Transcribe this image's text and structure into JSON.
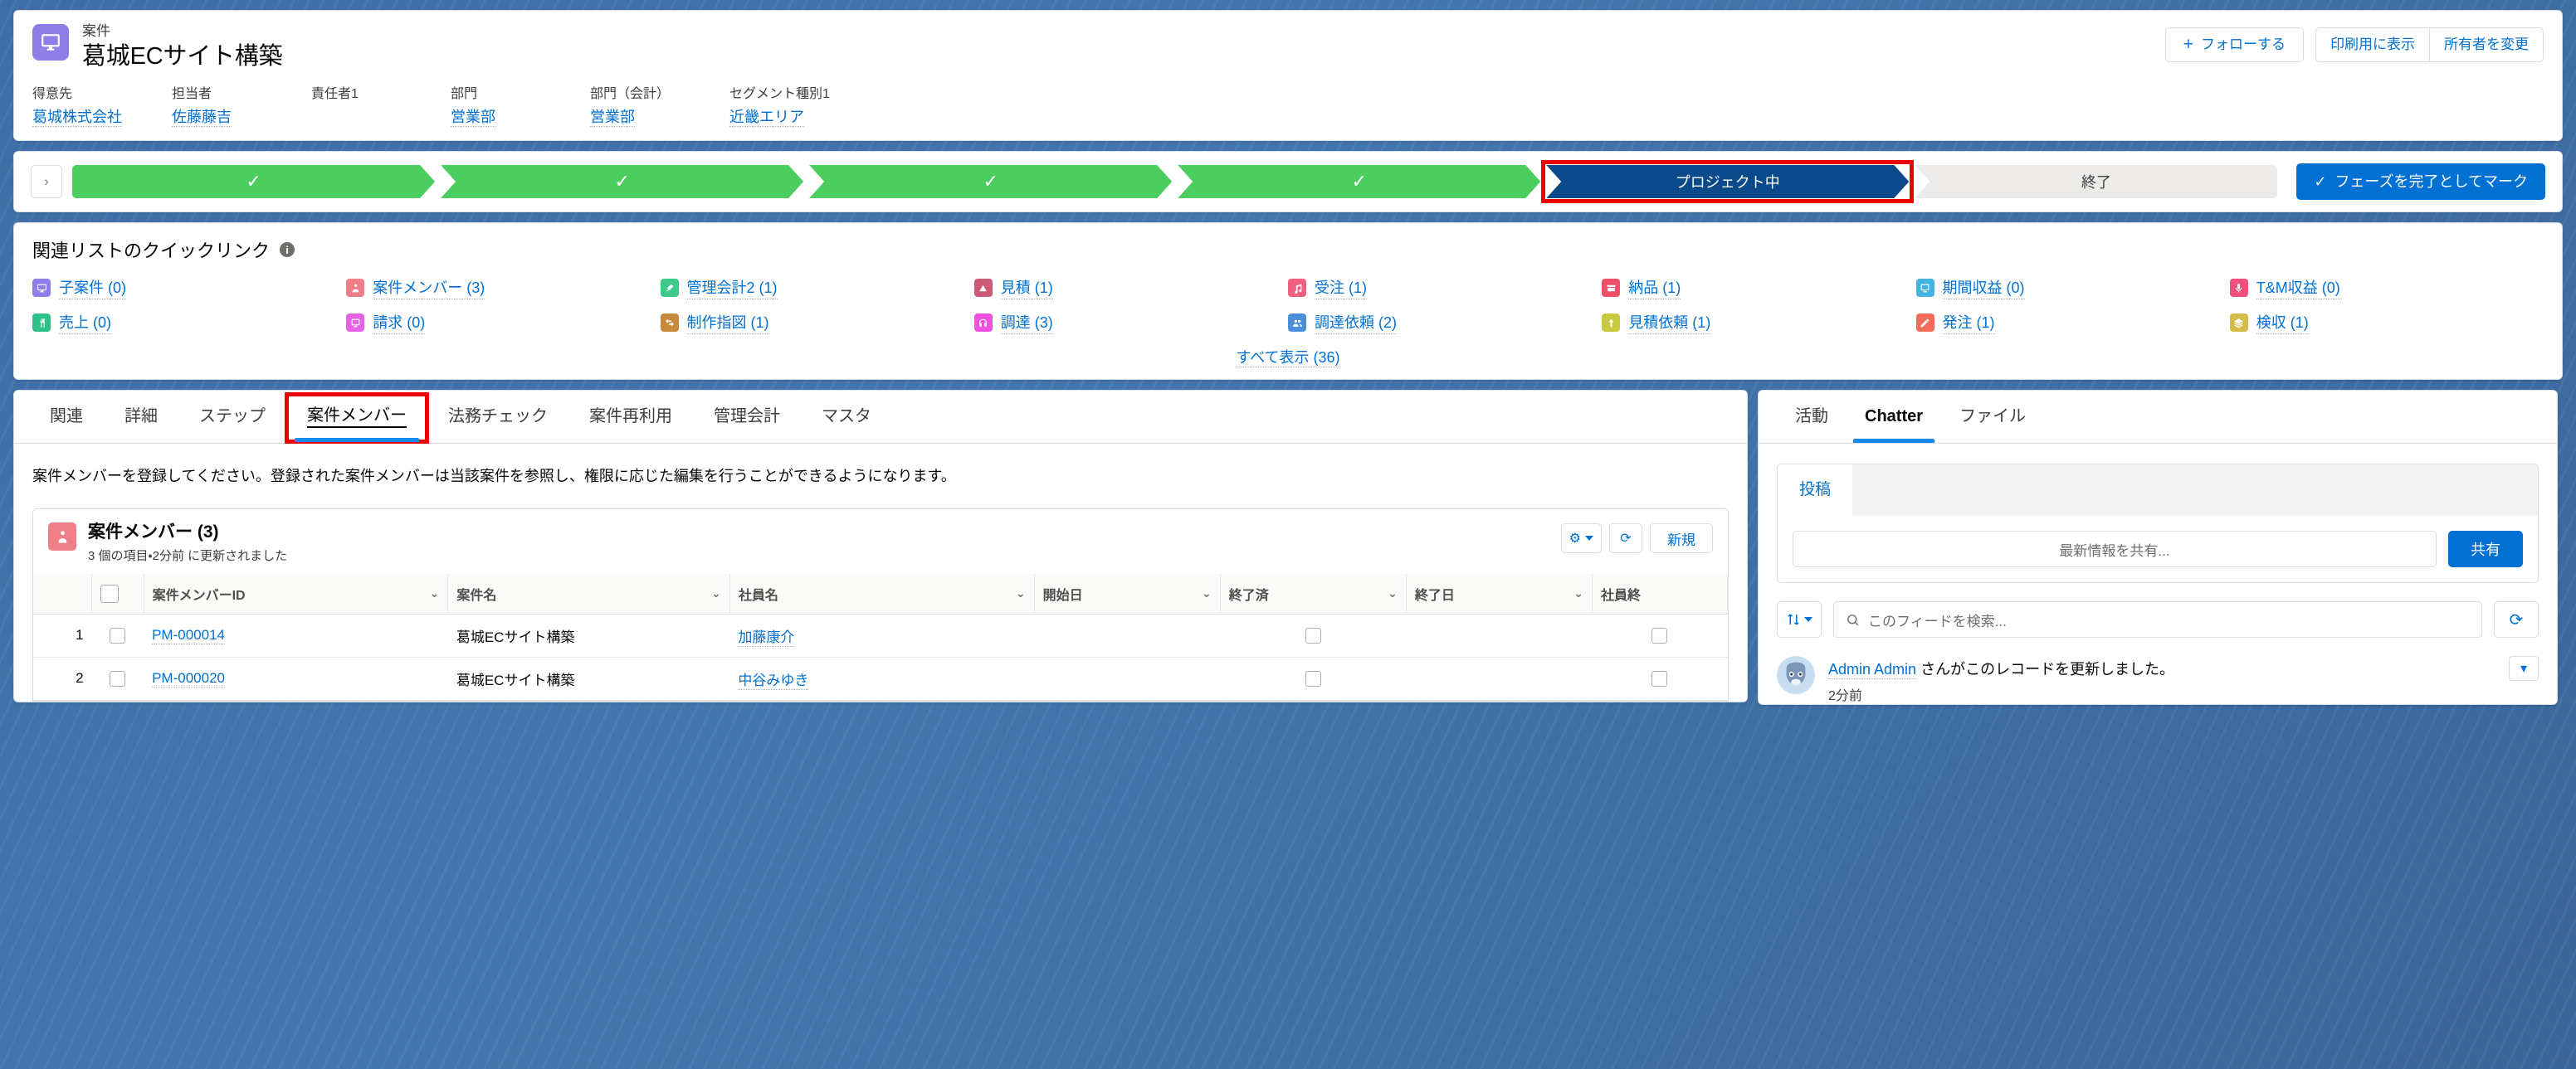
{
  "record": {
    "object_label": "案件",
    "title": "葛城ECサイト構築",
    "icon": "desktop-icon",
    "icon_color": "#8f7ee7"
  },
  "header_actions": {
    "follow": "フォローする",
    "follow_plus": "+",
    "printable_view": "印刷用に表示",
    "change_owner": "所有者を変更"
  },
  "highlight_fields": [
    {
      "label": "得意先",
      "value": "葛城株式会社",
      "is_link": true
    },
    {
      "label": "担当者",
      "value": "佐藤藤吉",
      "is_link": true
    },
    {
      "label": "責任者1",
      "value": "",
      "is_link": false
    },
    {
      "label": "部門",
      "value": "営業部",
      "is_link": true
    },
    {
      "label": "部門（会計）",
      "value": "営業部",
      "is_link": true
    },
    {
      "label": "セグメント種別1",
      "value": "近畿エリア",
      "is_link": true
    }
  ],
  "path": {
    "prev_label": "›",
    "stages": [
      {
        "label": "✓",
        "state": "done"
      },
      {
        "label": "✓",
        "state": "done"
      },
      {
        "label": "✓",
        "state": "done"
      },
      {
        "label": "✓",
        "state": "done"
      },
      {
        "label": "プロジェクト中",
        "state": "current",
        "highlighted": true
      },
      {
        "label": "終了",
        "state": "upcoming"
      }
    ],
    "mark_complete": "フェーズを完了としてマーク",
    "mark_complete_check": "✓",
    "highlight_color": "#ee0000",
    "done_color": "#4bce5f",
    "current_color": "#0b4a8a",
    "upcoming_color": "#ecebea"
  },
  "quick_links": {
    "title": "関連リストのクイックリンク",
    "info_glyph": "i",
    "show_all": "すべて表示 (36)",
    "items": [
      {
        "label": "子案件 (0)",
        "icon": "desktop-icon",
        "color": "#8f7ee7"
      },
      {
        "label": "案件メンバー (3)",
        "icon": "person-icon",
        "color": "#ee7e88"
      },
      {
        "label": "管理会計2 (1)",
        "icon": "pin-icon",
        "color": "#3cc98a"
      },
      {
        "label": "見積 (1)",
        "icon": "triangle-icon",
        "color": "#cc5a78"
      },
      {
        "label": "受注 (1)",
        "icon": "note-icon",
        "color": "#f0617f"
      },
      {
        "label": "納品 (1)",
        "icon": "box-icon",
        "color": "#ef4f6a"
      },
      {
        "label": "期間収益 (0)",
        "icon": "device-icon",
        "color": "#43b3e0"
      },
      {
        "label": "T&M収益 (0)",
        "icon": "mic-icon",
        "color": "#ef4f7a"
      },
      {
        "label": "売上 (0)",
        "icon": "fork-icon",
        "color": "#2fc08a"
      },
      {
        "label": "請求 (0)",
        "icon": "device-icon",
        "color": "#e563e5"
      },
      {
        "label": "制作指図 (1)",
        "icon": "swap-icon",
        "color": "#c8893d"
      },
      {
        "label": "調達 (3)",
        "icon": "headset-icon",
        "color": "#f050e0"
      },
      {
        "label": "調達依頼 (2)",
        "icon": "group-icon",
        "color": "#4a90d9"
      },
      {
        "label": "見積依頼 (1)",
        "icon": "arrowup-icon",
        "color": "#c9cb3f"
      },
      {
        "label": "発注 (1)",
        "icon": "pencil-icon",
        "color": "#f26c58"
      },
      {
        "label": "検収 (1)",
        "icon": "layers-icon",
        "color": "#d4bb4a"
      }
    ]
  },
  "tabs": {
    "items": [
      {
        "label": "関連",
        "active": false
      },
      {
        "label": "詳細",
        "active": false
      },
      {
        "label": "ステップ",
        "active": false
      },
      {
        "label": "案件メンバー",
        "active": true,
        "highlighted": true
      },
      {
        "label": "法務チェック",
        "active": false
      },
      {
        "label": "案件再利用",
        "active": false
      },
      {
        "label": "管理会計",
        "active": false
      },
      {
        "label": "マスタ",
        "active": false
      }
    ],
    "description": "案件メンバーを登録してください。登録された案件メンバーは当該案件を参照し、権限に応じた編集を行うことができるようになります。"
  },
  "related_list": {
    "icon": "person-icon",
    "icon_color": "#ee7e88",
    "title": "案件メンバー (3)",
    "subtitle": "3 個の項目・2分前 に更新されました",
    "actions": {
      "settings": "⚙",
      "refresh": "⟳",
      "new": "新規"
    },
    "columns": [
      {
        "label": "案件メンバーID",
        "sortable": true
      },
      {
        "label": "案件名",
        "sortable": true
      },
      {
        "label": "社員名",
        "sortable": true
      },
      {
        "label": "開始日",
        "sortable": true
      },
      {
        "label": "終了済",
        "sortable": true
      },
      {
        "label": "終了日",
        "sortable": true
      },
      {
        "label": "社員終",
        "sortable": false
      }
    ],
    "rows": [
      {
        "num": "1",
        "member_id": "PM-000014",
        "project_name": "葛城ECサイト構築",
        "employee": "加藤康介",
        "start_date": "",
        "finished": false,
        "end_date": "",
        "employee_end": false
      },
      {
        "num": "2",
        "member_id": "PM-000020",
        "project_name": "葛城ECサイト構築",
        "employee": "中谷みゆき",
        "start_date": "",
        "finished": false,
        "end_date": "",
        "employee_end": false
      }
    ]
  },
  "right_panel": {
    "tabs": [
      {
        "label": "活動",
        "active": false
      },
      {
        "label": "Chatter",
        "active": true
      },
      {
        "label": "ファイル",
        "active": false
      }
    ],
    "publisher": {
      "tab_label": "投稿",
      "placeholder": "最新情報を共有...",
      "share_button": "共有"
    },
    "feed_toolbar": {
      "sort_icon": "sort-icon",
      "search_placeholder": "このフィードを検索...",
      "search_icon": "search-icon",
      "refresh_icon": "refresh-icon"
    },
    "feed": [
      {
        "author": "Admin Admin",
        "text": " さんがこのレコードを更新しました。",
        "time": "2分前",
        "menu_icon": "chevron-down-icon"
      }
    ]
  }
}
